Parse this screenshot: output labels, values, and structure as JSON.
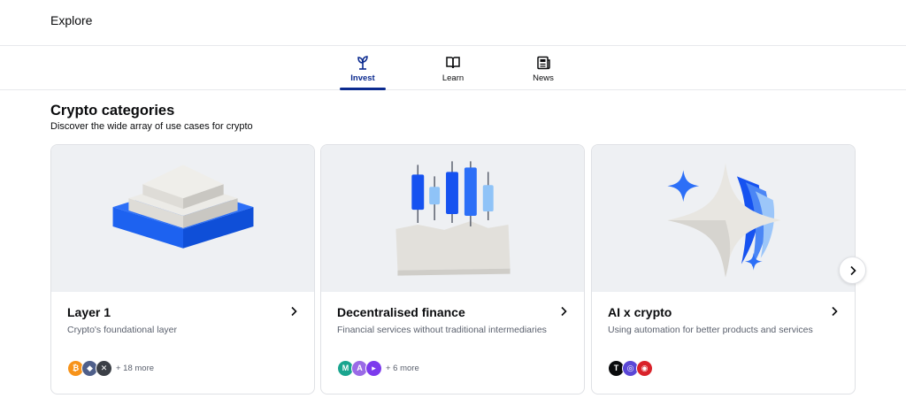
{
  "header": {
    "title": "Explore"
  },
  "tabs": [
    {
      "label": "Invest",
      "icon": "sprout-icon",
      "active": true
    },
    {
      "label": "Learn",
      "icon": "book-icon",
      "active": false
    },
    {
      "label": "News",
      "icon": "newspaper-icon",
      "active": false
    }
  ],
  "section": {
    "title": "Crypto categories",
    "subtitle": "Discover the wide array of use cases for crypto"
  },
  "cards": [
    {
      "title": "Layer 1",
      "description": "Crypto's foundational layer",
      "more": "+ 18 more",
      "coins": [
        {
          "symbol": "₿",
          "color": "#f7931a"
        },
        {
          "symbol": "◆",
          "color": "#4f5f8a"
        },
        {
          "symbol": "✕",
          "color": "#3b3f46"
        }
      ]
    },
    {
      "title": "Decentralised finance",
      "description": "Financial services without traditional intermediaries",
      "more": "+ 6 more",
      "coins": [
        {
          "symbol": "M",
          "color": "#1aa58f"
        },
        {
          "symbol": "A",
          "color": "#9a6ae6"
        },
        {
          "symbol": "▸",
          "color": "#7c3aed"
        }
      ]
    },
    {
      "title": "AI x crypto",
      "description": "Using automation for better products and services",
      "more": "",
      "coins": [
        {
          "symbol": "T",
          "color": "#0a0b0d"
        },
        {
          "symbol": "◎",
          "color": "#5b47d6"
        },
        {
          "symbol": "◉",
          "color": "#d9222a"
        }
      ]
    }
  ],
  "colors": {
    "accent": "#0b2a8f",
    "blue": "#1652f0",
    "card_bg": "#eef0f3"
  }
}
